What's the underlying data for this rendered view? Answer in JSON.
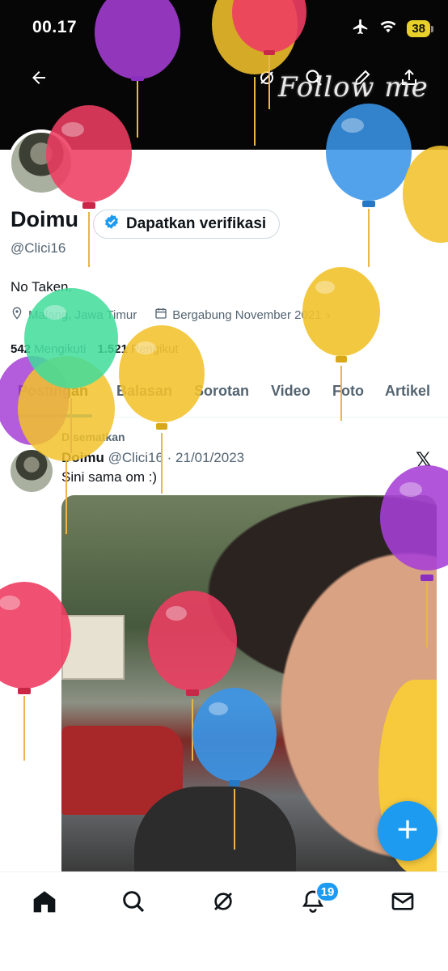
{
  "status_bar": {
    "time": "00.17",
    "battery": "38"
  },
  "banner": {
    "text": "Follow me"
  },
  "profile": {
    "name": "Doimu",
    "verify_label": "Dapatkan verifikasi",
    "handle": "@Clici16",
    "bio": "No Taken.",
    "location": "Malang, Jawa Timur",
    "joined": "Bergabung November 2021",
    "following_count": "542",
    "following_label": "Mengikuti",
    "followers_count": "1.521",
    "followers_label": "Pengikut"
  },
  "tabs": [
    "Postingan",
    "Balasan",
    "Sorotan",
    "Video",
    "Foto",
    "Artikel"
  ],
  "tweet": {
    "pinned_label": "Disematkan",
    "author": "Doimu",
    "handle": "@Clici16",
    "date": "21/01/2023",
    "text": "Sini sama om :)"
  },
  "bottom_nav": {
    "notification_badge": "19"
  },
  "colors": {
    "accent": "#1d9bf0",
    "banner": "#060606"
  }
}
